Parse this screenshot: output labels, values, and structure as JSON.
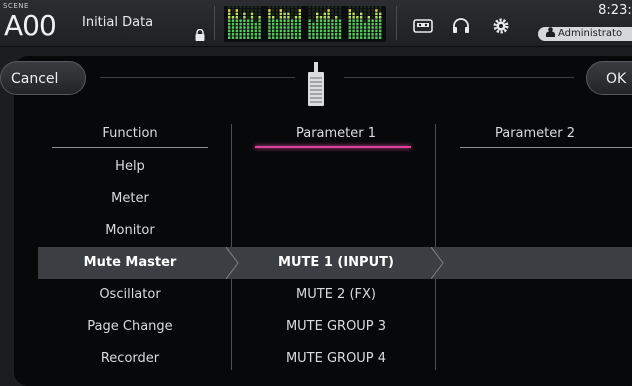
{
  "status_bar": {
    "scene_label": "SCENE",
    "scene_number": "A00",
    "scene_title": "Initial Data",
    "time": "8:23:4",
    "user": "Administrato",
    "meter_level_fractions": [
      0.85,
      0.7,
      0.9,
      0.6,
      0.75,
      0.55,
      0.8,
      0.5,
      0.65,
      0.9,
      0.7,
      0.6,
      0.85,
      0.75,
      0.8,
      0.55,
      0.7,
      0.9,
      0.6,
      0.5,
      0.75,
      0.65,
      0.8,
      0.85,
      0.55,
      0.7,
      0.6,
      0.9,
      0.75,
      0.65,
      0.8,
      0.5,
      0.7,
      0.6,
      0.85,
      0.75
    ],
    "icons": [
      "lock-icon",
      "meter-display",
      "tape-icon",
      "headphone-icon",
      "gear-icon",
      "user-icon"
    ]
  },
  "dialog": {
    "cancel_label": "Cancel",
    "ok_label": "OK",
    "icon": "fader-icon",
    "columns": {
      "function": "Function",
      "parameter1": "Parameter 1",
      "parameter2": "Parameter 2"
    },
    "function_items": [
      "Help",
      "Meter",
      "Monitor",
      "Mute Master",
      "Oscillator",
      "Page Change",
      "Recorder"
    ],
    "selected_function": "Mute Master",
    "parameter1_items": [
      "MUTE 1 (INPUT)",
      "MUTE 2 (FX)",
      "MUTE GROUP 3",
      "MUTE GROUP 4"
    ],
    "selected_parameter1": "MUTE 1 (INPUT)",
    "colors": {
      "accent": "#e040a0",
      "selected_row": "#3b3e43",
      "panel": "#070809"
    }
  }
}
